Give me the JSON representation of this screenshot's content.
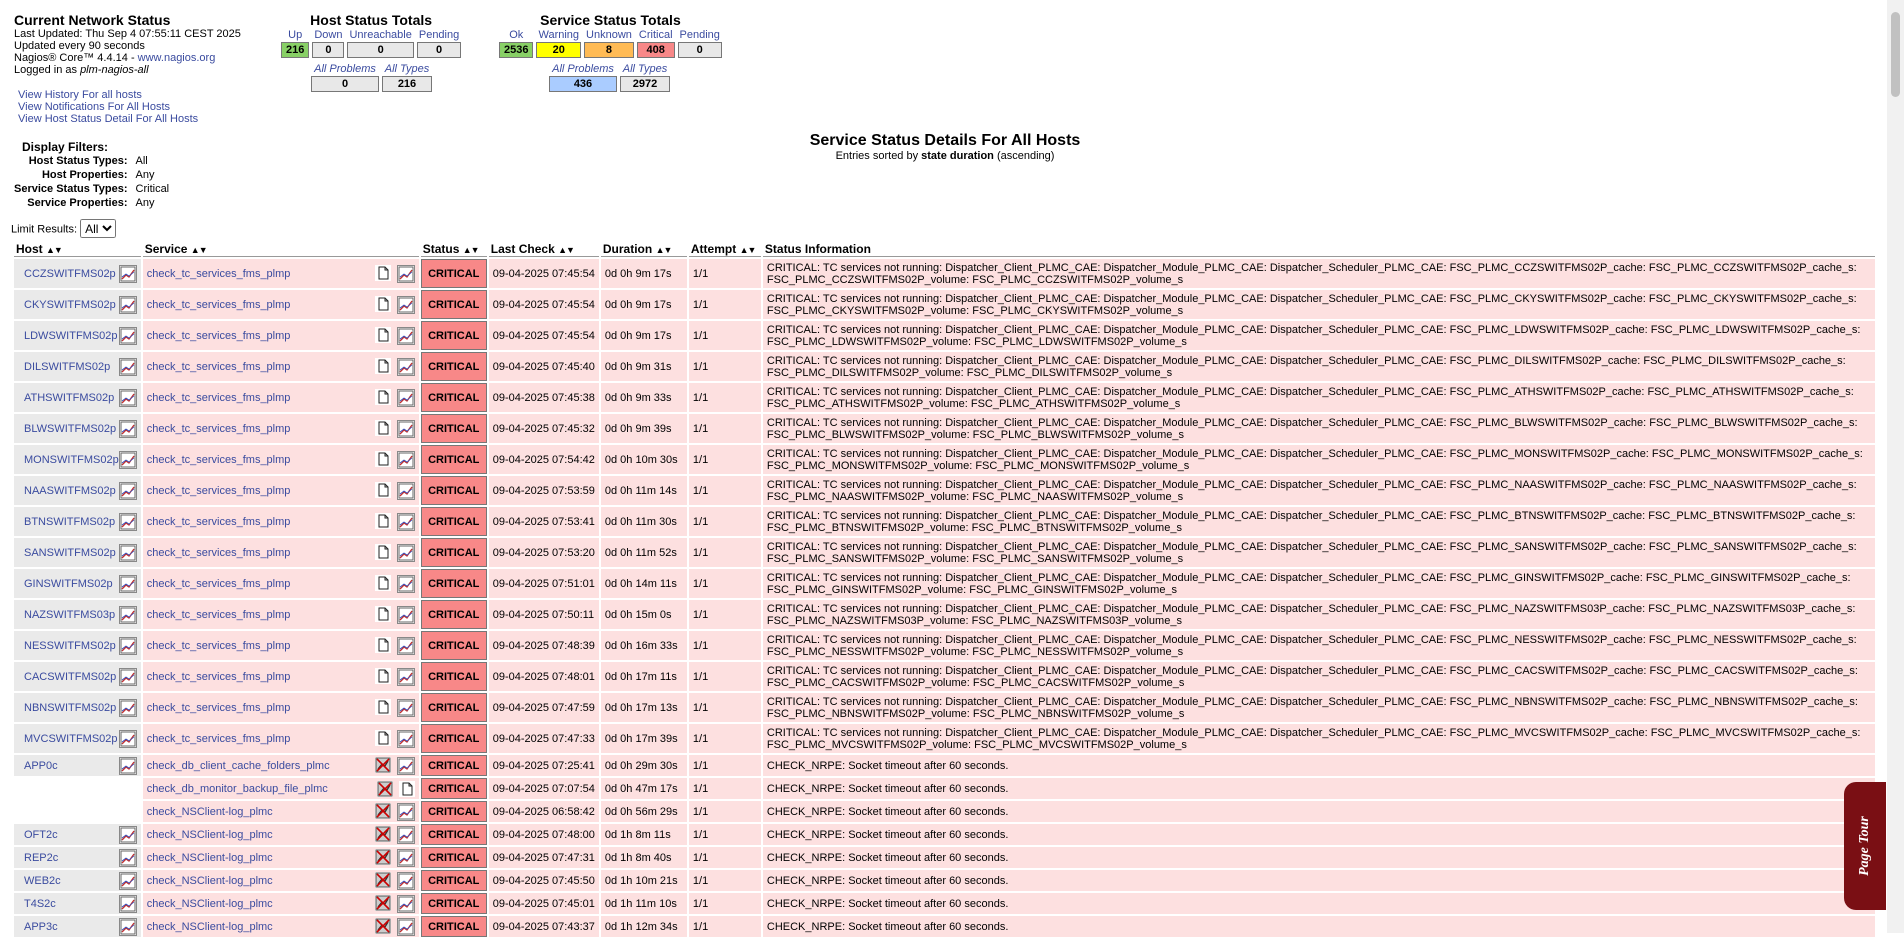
{
  "info": {
    "title": "Current Network Status",
    "updated": "Last Updated: Thu Sep 4 07:55:11 CEST 2025",
    "interval": "Updated every 90 seconds",
    "version_prefix": "Nagios® Core™ 4.4.14 - ",
    "version_link": "www.nagios.org",
    "logged_prefix": "Logged in as ",
    "logged_user": "plm-nagios-all"
  },
  "links": [
    "View History For all hosts",
    "View Notifications For All Hosts",
    "View Host Status Detail For All Hosts"
  ],
  "host_totals": {
    "title": "Host Status Totals",
    "headers": [
      "Up",
      "Down",
      "Unreachable",
      "Pending"
    ],
    "values": [
      "216",
      "0",
      "0",
      "0"
    ],
    "colors": [
      "#88d066",
      "#e8e8e8",
      "#e8e8e8",
      "#e8e8e8"
    ],
    "sub_headers": [
      "All Problems",
      "All Types"
    ],
    "sub_values": [
      "0",
      "216"
    ]
  },
  "service_totals": {
    "title": "Service Status Totals",
    "headers": [
      "Ok",
      "Warning",
      "Unknown",
      "Critical",
      "Pending"
    ],
    "values": [
      "2536",
      "20",
      "8",
      "408",
      "0"
    ],
    "colors": [
      "#88d066",
      "#ffff00",
      "#ffbb55",
      "#f88888",
      "#e8e8e8"
    ],
    "sub_headers": [
      "All Problems",
      "All Types"
    ],
    "sub_values": [
      "436",
      "2972"
    ],
    "sub_colors": [
      "#aaccff",
      "#e8e8e8"
    ]
  },
  "filters": {
    "heading": "Display Filters:",
    "rows": [
      {
        "k": "Host Status Types:",
        "v": "All"
      },
      {
        "k": "Host Properties:",
        "v": "Any"
      },
      {
        "k": "Service Status Types:",
        "v": "Critical"
      },
      {
        "k": "Service Properties:",
        "v": "Any"
      }
    ]
  },
  "limit": {
    "label": "Limit Results:",
    "value": "All"
  },
  "center": {
    "title": "Service Status Details For All Hosts",
    "sorted_prefix": "Entries sorted by ",
    "sorted_key": "state duration",
    "sorted_suffix": " (ascending)"
  },
  "columns": [
    "Host",
    "Service",
    "Status",
    "Last Check",
    "Duration",
    "Attempt",
    "Status Information"
  ],
  "rows": [
    {
      "host": "CCZSWITFMS02p",
      "service": "check_tc_services_fms_plmp",
      "icon": "doc",
      "status": "CRITICAL",
      "last": "09-04-2025 07:45:54",
      "dur": "0d 0h 9m 17s",
      "att": "1/1",
      "info": "CRITICAL: TC services not running: Dispatcher_Client_PLMC_CAE: Dispatcher_Module_PLMC_CAE: Dispatcher_Scheduler_PLMC_CAE: FSC_PLMC_CCZSWITFMS02P_cache: FSC_PLMC_CCZSWITFMS02P_cache_s: FSC_PLMC_CCZSWITFMS02P_volume: FSC_PLMC_CCZSWITFMS02P_volume_s"
    },
    {
      "host": "CKYSWITFMS02p",
      "service": "check_tc_services_fms_plmp",
      "icon": "doc",
      "status": "CRITICAL",
      "last": "09-04-2025 07:45:54",
      "dur": "0d 0h 9m 17s",
      "att": "1/1",
      "info": "CRITICAL: TC services not running: Dispatcher_Client_PLMC_CAE: Dispatcher_Module_PLMC_CAE: Dispatcher_Scheduler_PLMC_CAE: FSC_PLMC_CKYSWITFMS02P_cache: FSC_PLMC_CKYSWITFMS02P_cache_s: FSC_PLMC_CKYSWITFMS02P_volume: FSC_PLMC_CKYSWITFMS02P_volume_s"
    },
    {
      "host": "LDWSWITFMS02p",
      "service": "check_tc_services_fms_plmp",
      "icon": "doc",
      "status": "CRITICAL",
      "last": "09-04-2025 07:45:54",
      "dur": "0d 0h 9m 17s",
      "att": "1/1",
      "info": "CRITICAL: TC services not running: Dispatcher_Client_PLMC_CAE: Dispatcher_Module_PLMC_CAE: Dispatcher_Scheduler_PLMC_CAE: FSC_PLMC_LDWSWITFMS02P_cache: FSC_PLMC_LDWSWITFMS02P_cache_s: FSC_PLMC_LDWSWITFMS02P_volume: FSC_PLMC_LDWSWITFMS02P_volume_s"
    },
    {
      "host": "DILSWITFMS02p",
      "service": "check_tc_services_fms_plmp",
      "icon": "doc",
      "status": "CRITICAL",
      "last": "09-04-2025 07:45:40",
      "dur": "0d 0h 9m 31s",
      "att": "1/1",
      "info": "CRITICAL: TC services not running: Dispatcher_Client_PLMC_CAE: Dispatcher_Module_PLMC_CAE: Dispatcher_Scheduler_PLMC_CAE: FSC_PLMC_DILSWITFMS02P_cache: FSC_PLMC_DILSWITFMS02P_cache_s: FSC_PLMC_DILSWITFMS02P_volume: FSC_PLMC_DILSWITFMS02P_volume_s"
    },
    {
      "host": "ATHSWITFMS02p",
      "service": "check_tc_services_fms_plmp",
      "icon": "doc",
      "status": "CRITICAL",
      "last": "09-04-2025 07:45:38",
      "dur": "0d 0h 9m 33s",
      "att": "1/1",
      "info": "CRITICAL: TC services not running: Dispatcher_Client_PLMC_CAE: Dispatcher_Module_PLMC_CAE: Dispatcher_Scheduler_PLMC_CAE: FSC_PLMC_ATHSWITFMS02P_cache: FSC_PLMC_ATHSWITFMS02P_cache_s: FSC_PLMC_ATHSWITFMS02P_volume: FSC_PLMC_ATHSWITFMS02P_volume_s"
    },
    {
      "host": "BLWSWITFMS02p",
      "service": "check_tc_services_fms_plmp",
      "icon": "doc",
      "status": "CRITICAL",
      "last": "09-04-2025 07:45:32",
      "dur": "0d 0h 9m 39s",
      "att": "1/1",
      "info": "CRITICAL: TC services not running: Dispatcher_Client_PLMC_CAE: Dispatcher_Module_PLMC_CAE: Dispatcher_Scheduler_PLMC_CAE: FSC_PLMC_BLWSWITFMS02P_cache: FSC_PLMC_BLWSWITFMS02P_cache_s: FSC_PLMC_BLWSWITFMS02P_volume: FSC_PLMC_BLWSWITFMS02P_volume_s"
    },
    {
      "host": "MONSWITFMS02p",
      "service": "check_tc_services_fms_plmp",
      "icon": "doc",
      "status": "CRITICAL",
      "last": "09-04-2025 07:54:42",
      "dur": "0d 0h 10m 30s",
      "att": "1/1",
      "info": "CRITICAL: TC services not running: Dispatcher_Client_PLMC_CAE: Dispatcher_Module_PLMC_CAE: Dispatcher_Scheduler_PLMC_CAE: FSC_PLMC_MONSWITFMS02P_cache: FSC_PLMC_MONSWITFMS02P_cache_s: FSC_PLMC_MONSWITFMS02P_volume: FSC_PLMC_MONSWITFMS02P_volume_s"
    },
    {
      "host": "NAASWITFMS02p",
      "service": "check_tc_services_fms_plmp",
      "icon": "doc",
      "status": "CRITICAL",
      "last": "09-04-2025 07:53:59",
      "dur": "0d 0h 11m 14s",
      "att": "1/1",
      "info": "CRITICAL: TC services not running: Dispatcher_Client_PLMC_CAE: Dispatcher_Module_PLMC_CAE: Dispatcher_Scheduler_PLMC_CAE: FSC_PLMC_NAASWITFMS02P_cache: FSC_PLMC_NAASWITFMS02P_cache_s: FSC_PLMC_NAASWITFMS02P_volume: FSC_PLMC_NAASWITFMS02P_volume_s"
    },
    {
      "host": "BTNSWITFMS02p",
      "service": "check_tc_services_fms_plmp",
      "icon": "doc",
      "status": "CRITICAL",
      "last": "09-04-2025 07:53:41",
      "dur": "0d 0h 11m 30s",
      "att": "1/1",
      "info": "CRITICAL: TC services not running: Dispatcher_Client_PLMC_CAE: Dispatcher_Module_PLMC_CAE: Dispatcher_Scheduler_PLMC_CAE: FSC_PLMC_BTNSWITFMS02P_cache: FSC_PLMC_BTNSWITFMS02P_cache_s: FSC_PLMC_BTNSWITFMS02P_volume: FSC_PLMC_BTNSWITFMS02P_volume_s"
    },
    {
      "host": "SANSWITFMS02p",
      "service": "check_tc_services_fms_plmp",
      "icon": "doc",
      "status": "CRITICAL",
      "last": "09-04-2025 07:53:20",
      "dur": "0d 0h 11m 52s",
      "att": "1/1",
      "info": "CRITICAL: TC services not running: Dispatcher_Client_PLMC_CAE: Dispatcher_Module_PLMC_CAE: Dispatcher_Scheduler_PLMC_CAE: FSC_PLMC_SANSWITFMS02P_cache: FSC_PLMC_SANSWITFMS02P_cache_s: FSC_PLMC_SANSWITFMS02P_volume: FSC_PLMC_SANSWITFMS02P_volume_s"
    },
    {
      "host": "GINSWITFMS02p",
      "service": "check_tc_services_fms_plmp",
      "icon": "doc",
      "status": "CRITICAL",
      "last": "09-04-2025 07:51:01",
      "dur": "0d 0h 14m 11s",
      "att": "1/1",
      "info": "CRITICAL: TC services not running: Dispatcher_Client_PLMC_CAE: Dispatcher_Module_PLMC_CAE: Dispatcher_Scheduler_PLMC_CAE: FSC_PLMC_GINSWITFMS02P_cache: FSC_PLMC_GINSWITFMS02P_cache_s: FSC_PLMC_GINSWITFMS02P_volume: FSC_PLMC_GINSWITFMS02P_volume_s"
    },
    {
      "host": "NAZSWITFMS03p",
      "service": "check_tc_services_fms_plmp",
      "icon": "doc",
      "status": "CRITICAL",
      "last": "09-04-2025 07:50:11",
      "dur": "0d 0h 15m 0s",
      "att": "1/1",
      "info": "CRITICAL: TC services not running: Dispatcher_Client_PLMC_CAE: Dispatcher_Module_PLMC_CAE: Dispatcher_Scheduler_PLMC_CAE: FSC_PLMC_NAZSWITFMS03P_cache: FSC_PLMC_NAZSWITFMS03P_cache_s: FSC_PLMC_NAZSWITFMS03P_volume: FSC_PLMC_NAZSWITFMS03P_volume_s"
    },
    {
      "host": "NESSWITFMS02p",
      "service": "check_tc_services_fms_plmp",
      "icon": "doc",
      "status": "CRITICAL",
      "last": "09-04-2025 07:48:39",
      "dur": "0d 0h 16m 33s",
      "att": "1/1",
      "info": "CRITICAL: TC services not running: Dispatcher_Client_PLMC_CAE: Dispatcher_Module_PLMC_CAE: Dispatcher_Scheduler_PLMC_CAE: FSC_PLMC_NESSWITFMS02P_cache: FSC_PLMC_NESSWITFMS02P_cache_s: FSC_PLMC_NESSWITFMS02P_volume: FSC_PLMC_NESSWITFMS02P_volume_s"
    },
    {
      "host": "CACSWITFMS02p",
      "service": "check_tc_services_fms_plmp",
      "icon": "doc",
      "status": "CRITICAL",
      "last": "09-04-2025 07:48:01",
      "dur": "0d 0h 17m 11s",
      "att": "1/1",
      "info": "CRITICAL: TC services not running: Dispatcher_Client_PLMC_CAE: Dispatcher_Module_PLMC_CAE: Dispatcher_Scheduler_PLMC_CAE: FSC_PLMC_CACSWITFMS02P_cache: FSC_PLMC_CACSWITFMS02P_cache_s: FSC_PLMC_CACSWITFMS02P_volume: FSC_PLMC_CACSWITFMS02P_volume_s"
    },
    {
      "host": "NBNSWITFMS02p",
      "service": "check_tc_services_fms_plmp",
      "icon": "doc",
      "status": "CRITICAL",
      "last": "09-04-2025 07:47:59",
      "dur": "0d 0h 17m 13s",
      "att": "1/1",
      "info": "CRITICAL: TC services not running: Dispatcher_Client_PLMC_CAE: Dispatcher_Module_PLMC_CAE: Dispatcher_Scheduler_PLMC_CAE: FSC_PLMC_NBNSWITFMS02P_cache: FSC_PLMC_NBNSWITFMS02P_cache_s: FSC_PLMC_NBNSWITFMS02P_volume: FSC_PLMC_NBNSWITFMS02P_volume_s"
    },
    {
      "host": "MVCSWITFMS02p",
      "service": "check_tc_services_fms_plmp",
      "icon": "doc",
      "status": "CRITICAL",
      "last": "09-04-2025 07:47:33",
      "dur": "0d 0h 17m 39s",
      "att": "1/1",
      "info": "CRITICAL: TC services not running: Dispatcher_Client_PLMC_CAE: Dispatcher_Module_PLMC_CAE: Dispatcher_Scheduler_PLMC_CAE: FSC_PLMC_MVCSWITFMS02P_cache: FSC_PLMC_MVCSWITFMS02P_cache_s: FSC_PLMC_MVCSWITFMS02P_volume: FSC_PLMC_MVCSWITFMS02P_volume_s"
    },
    {
      "host": "APP0c",
      "service": "check_db_client_cache_folders_plmc",
      "icon": "disabled",
      "icon2": "graph",
      "status": "CRITICAL",
      "last": "09-04-2025 07:25:41",
      "dur": "0d 0h 29m 30s",
      "att": "1/1",
      "info": "CHECK_NRPE: Socket timeout after 60 seconds."
    },
    {
      "host": "",
      "service": "check_db_monitor_backup_file_plmc",
      "icon": "disabled",
      "icon2": "doc",
      "status": "CRITICAL",
      "last": "09-04-2025 07:07:54",
      "dur": "0d 0h 47m 17s",
      "att": "1/1",
      "info": "CHECK_NRPE: Socket timeout after 60 seconds."
    },
    {
      "host": "",
      "service": "check_NSClient-log_plmc",
      "icon": "disabled",
      "icon2": "graph",
      "status": "CRITICAL",
      "last": "09-04-2025 06:58:42",
      "dur": "0d 0h 56m 29s",
      "att": "1/1",
      "info": "CHECK_NRPE: Socket timeout after 60 seconds."
    },
    {
      "host": "OFT2c",
      "service": "check_NSClient-log_plmc",
      "icon": "disabled",
      "icon2": "graph",
      "status": "CRITICAL",
      "last": "09-04-2025 07:48:00",
      "dur": "0d 1h 8m 11s",
      "att": "1/1",
      "info": "CHECK_NRPE: Socket timeout after 60 seconds."
    },
    {
      "host": "REP2c",
      "service": "check_NSClient-log_plmc",
      "icon": "disabled",
      "icon2": "graph",
      "status": "CRITICAL",
      "last": "09-04-2025 07:47:31",
      "dur": "0d 1h 8m 40s",
      "att": "1/1",
      "info": "CHECK_NRPE: Socket timeout after 60 seconds."
    },
    {
      "host": "WEB2c",
      "service": "check_NSClient-log_plmc",
      "icon": "disabled",
      "icon2": "graph",
      "status": "CRITICAL",
      "last": "09-04-2025 07:45:50",
      "dur": "0d 1h 10m 21s",
      "att": "1/1",
      "info": "CHECK_NRPE: Socket timeout after 60 seconds."
    },
    {
      "host": "T4S2c",
      "service": "check_NSClient-log_plmc",
      "icon": "disabled",
      "icon2": "graph",
      "status": "CRITICAL",
      "last": "09-04-2025 07:45:01",
      "dur": "0d 1h 11m 10s",
      "att": "1/1",
      "info": "CHECK_NRPE: Socket timeout after 60 seconds."
    },
    {
      "host": "APP3c",
      "service": "check_NSClient-log_plmc",
      "icon": "disabled",
      "icon2": "graph",
      "status": "CRITICAL",
      "last": "09-04-2025 07:43:37",
      "dur": "0d 1h 12m 34s",
      "att": "1/1",
      "info": "CHECK_NRPE: Socket timeout after 60 seconds."
    }
  ],
  "tour": {
    "label": "Page Tour"
  }
}
